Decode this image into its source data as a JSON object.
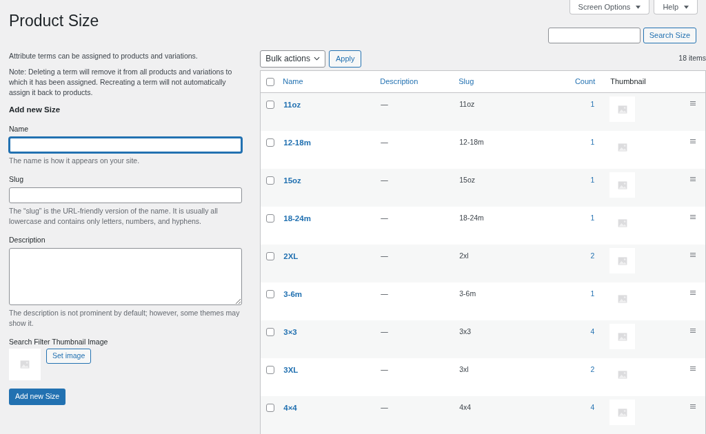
{
  "header_tabs": [
    {
      "label": "Screen Options"
    },
    {
      "label": "Help"
    }
  ],
  "title": "Product Size",
  "search": {
    "button": "Search Size"
  },
  "form": {
    "intro": "Attribute terms can be assigned to products and variations.",
    "note": "Note: Deleting a term will remove it from all products and variations to which it has been assigned. Recreating a term will not automatically assign it back to products.",
    "heading": "Add new Size",
    "fields": [
      {
        "kind": "input",
        "label": "Name",
        "focused": true,
        "help": "The name is how it appears on your site."
      },
      {
        "kind": "input",
        "label": "Slug",
        "focused": false,
        "help": "The “slug” is the URL-friendly version of the name. It is usually all lowercase and contains only letters, numbers, and hyphens."
      },
      {
        "kind": "textarea",
        "label": "Description",
        "focused": false,
        "help": "The description is not prominent by default; however, some themes may show it."
      }
    ],
    "thumbnail_label": "Search Filter Thumbnail Image",
    "set_image_button": "Set image",
    "submit": "Add new Size"
  },
  "toolbar": {
    "bulk_actions": "Bulk actions",
    "apply": "Apply",
    "items_count": "18 items"
  },
  "table": {
    "select_all_checked": false,
    "columns": [
      "Name",
      "Description",
      "Slug",
      "Count",
      "Thumbnail"
    ],
    "rows": [
      {
        "name": "11oz",
        "description": "—",
        "slug": "11oz",
        "count": "1",
        "checked": false
      },
      {
        "name": "12-18m",
        "description": "—",
        "slug": "12-18m",
        "count": "1",
        "checked": false
      },
      {
        "name": "15oz",
        "description": "—",
        "slug": "15oz",
        "count": "1",
        "checked": false
      },
      {
        "name": "18-24m",
        "description": "—",
        "slug": "18-24m",
        "count": "1",
        "checked": false
      },
      {
        "name": "2XL",
        "description": "—",
        "slug": "2xl",
        "count": "2",
        "checked": false
      },
      {
        "name": "3-6m",
        "description": "—",
        "slug": "3-6m",
        "count": "1",
        "checked": false
      },
      {
        "name": "3×3",
        "description": "—",
        "slug": "3x3",
        "count": "4",
        "checked": false
      },
      {
        "name": "3XL",
        "description": "—",
        "slug": "3xl",
        "count": "2",
        "checked": false
      },
      {
        "name": "4×4",
        "description": "—",
        "slug": "4x4",
        "count": "4",
        "checked": false
      }
    ]
  }
}
